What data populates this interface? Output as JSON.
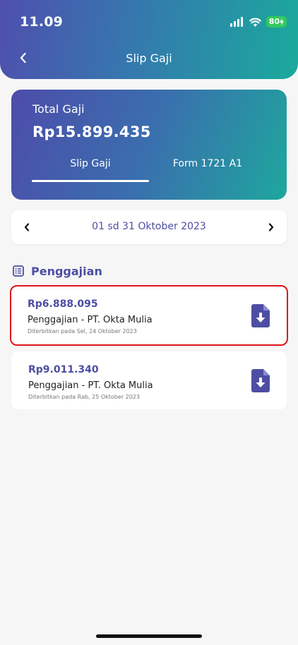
{
  "status_bar": {
    "time": "11.09",
    "battery": "80"
  },
  "header": {
    "title": "Slip Gaji"
  },
  "summary": {
    "label": "Total Gaji",
    "amount": "Rp15.899.435",
    "tabs": [
      {
        "label": "Slip Gaji",
        "active": true
      },
      {
        "label": "Form 1721 A1",
        "active": false
      }
    ]
  },
  "period": {
    "label": "01 sd 31 Oktober 2023"
  },
  "section": {
    "title": "Penggajian"
  },
  "payslips": [
    {
      "amount": "Rp6.888.095",
      "description": "Penggajian - PT. Okta Mulia",
      "date": "Diterbitkan pada Sel, 24 Oktober 2023",
      "highlighted": true
    },
    {
      "amount": "Rp9.011.340",
      "description": "Penggajian - PT. Okta Mulia",
      "date": "Diterbitkan pada Rab, 25 Oktober 2023",
      "highlighted": false
    }
  ],
  "colors": {
    "accent": "#4d4ea3",
    "highlight_border": "#e0141b",
    "gradient_start": "#4f4fae",
    "gradient_end": "#1aaa9c",
    "battery": "#31c95e"
  },
  "icons": {
    "back": "chevron-left-icon",
    "prev": "chevron-left-icon",
    "next": "chevron-right-icon",
    "section": "list-document-icon",
    "download": "file-download-icon"
  }
}
